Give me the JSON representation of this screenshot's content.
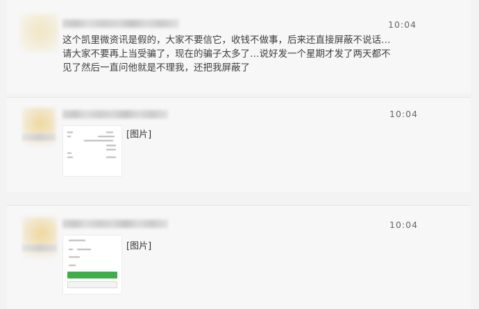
{
  "posts": [
    {
      "time": "10:04",
      "message": "这个凯里微资讯是假的，大家不要信它，收钱不做事，后来还直接屏蔽不说话…请大家不要再上当受骗了，现在的骗子太多了…说好发一个星期才发了两天都不见了然后一直问他就是不理我，还把我屏蔽了"
    },
    {
      "time": "10:04",
      "image_label": "[图片]"
    },
    {
      "time": "10:04",
      "image_label": "[图片]"
    }
  ],
  "colors": {
    "background": "#f3f3f3",
    "card": "#f7f7f7",
    "green_button": "#3fae49"
  }
}
